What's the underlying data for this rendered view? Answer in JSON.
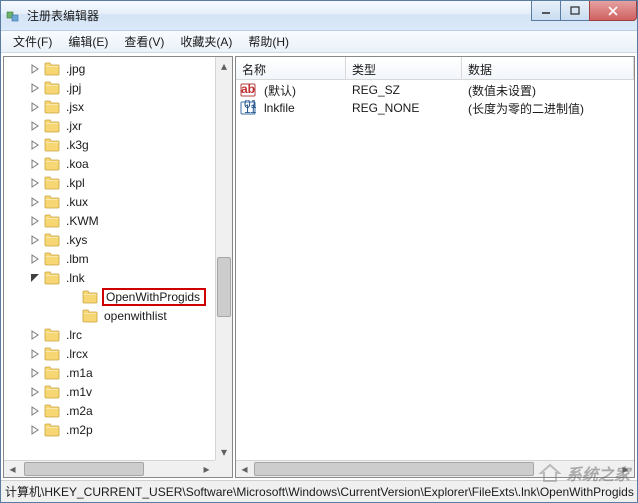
{
  "window": {
    "title": "注册表编辑器"
  },
  "menu": {
    "file": "文件(F)",
    "edit": "编辑(E)",
    "view": "查看(V)",
    "favorites": "收藏夹(A)",
    "help": "帮助(H)"
  },
  "tree": {
    "items": [
      {
        "indent": 2,
        "expander": "closed",
        "label": ".jpg"
      },
      {
        "indent": 2,
        "expander": "closed",
        "label": ".jpj"
      },
      {
        "indent": 2,
        "expander": "closed",
        "label": ".jsx"
      },
      {
        "indent": 2,
        "expander": "closed",
        "label": ".jxr"
      },
      {
        "indent": 2,
        "expander": "closed",
        "label": ".k3g"
      },
      {
        "indent": 2,
        "expander": "closed",
        "label": ".koa"
      },
      {
        "indent": 2,
        "expander": "closed",
        "label": ".kpl"
      },
      {
        "indent": 2,
        "expander": "closed",
        "label": ".kux"
      },
      {
        "indent": 2,
        "expander": "closed",
        "label": ".KWM"
      },
      {
        "indent": 2,
        "expander": "closed",
        "label": ".kys"
      },
      {
        "indent": 2,
        "expander": "closed",
        "label": ".lbm"
      },
      {
        "indent": 2,
        "expander": "open",
        "label": ".lnk"
      },
      {
        "indent": 4,
        "expander": "none",
        "label": "OpenWithProgids",
        "selected": true
      },
      {
        "indent": 4,
        "expander": "none",
        "label": "openwithlist"
      },
      {
        "indent": 2,
        "expander": "closed",
        "label": ".lrc"
      },
      {
        "indent": 2,
        "expander": "closed",
        "label": ".lrcx"
      },
      {
        "indent": 2,
        "expander": "closed",
        "label": ".m1a"
      },
      {
        "indent": 2,
        "expander": "closed",
        "label": ".m1v"
      },
      {
        "indent": 2,
        "expander": "closed",
        "label": ".m2a"
      },
      {
        "indent": 2,
        "expander": "closed",
        "label": ".m2p"
      }
    ]
  },
  "list": {
    "columns": {
      "name": "名称",
      "type": "类型",
      "data": "数据"
    },
    "rows": [
      {
        "icon": "string",
        "name": "(默认)",
        "type": "REG_SZ",
        "data": "(数值未设置)"
      },
      {
        "icon": "binary",
        "name": "lnkfile",
        "type": "REG_NONE",
        "data": "(长度为零的二进制值)"
      }
    ]
  },
  "statusbar": {
    "path": "计算机\\HKEY_CURRENT_USER\\Software\\Microsoft\\Windows\\CurrentVersion\\Explorer\\FileExts\\.lnk\\OpenWithProgids"
  },
  "watermark": {
    "text": "系统之家"
  }
}
